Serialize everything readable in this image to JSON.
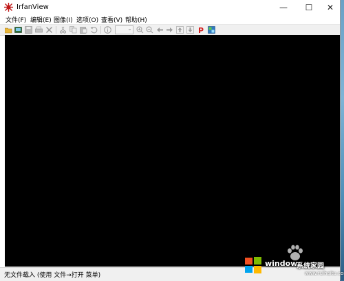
{
  "app": {
    "title": "IrfanView"
  },
  "window_controls": {
    "minimize": "—",
    "maximize": "☐",
    "close": "✕"
  },
  "menu": [
    {
      "label": "文件(F)"
    },
    {
      "label": "编辑(E)"
    },
    {
      "label": "图像(I)"
    },
    {
      "label": "选项(O)"
    },
    {
      "label": "查看(V)"
    },
    {
      "label": "帮助(H)"
    }
  ],
  "toolbar": {
    "icons": [
      "open-icon",
      "slideshow-icon",
      "save-icon",
      "print-icon",
      "delete-icon",
      "cut-icon",
      "copy-icon",
      "paste-icon",
      "undo-icon",
      "info-icon",
      "zoom-in-icon",
      "zoom-out-icon",
      "previous-icon",
      "next-icon",
      "first-icon",
      "last-icon",
      "paint-icon",
      "thumbnails-icon"
    ]
  },
  "status": {
    "text": "无文件载入 (使用 文件→打开 菜单)"
  },
  "watermark": {
    "brand": "windows",
    "suffix": "系统家园",
    "url": "www.ruihaitu.com"
  },
  "colors": {
    "canvas": "#000000",
    "accent_red": "#d32020"
  }
}
